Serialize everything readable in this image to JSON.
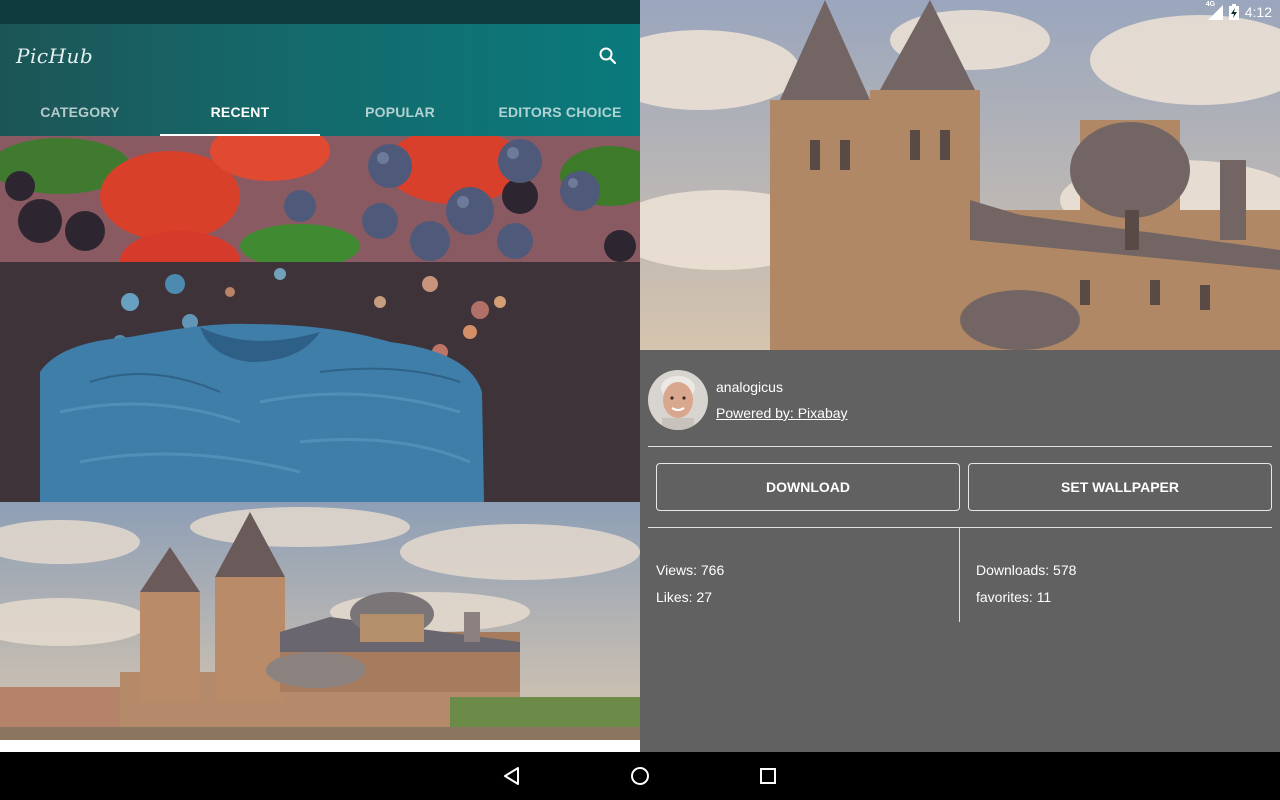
{
  "status": {
    "network": "4G",
    "time": "4:12"
  },
  "app": {
    "title": "PicHub"
  },
  "tabs": [
    {
      "label": "CATEGORY",
      "active": false
    },
    {
      "label": "RECENT",
      "active": true
    },
    {
      "label": "POPULAR",
      "active": false
    },
    {
      "label": "EDITORS CHOICE",
      "active": false
    }
  ],
  "feed": [
    {
      "subject": "berries"
    },
    {
      "subject": "blue sweater"
    },
    {
      "subject": "cathedral"
    }
  ],
  "detail": {
    "author": "analogicus",
    "powered_by": "Powered by: Pixabay",
    "download_label": "DOWNLOAD",
    "set_wallpaper_label": "SET WALLPAPER",
    "views": "Views: 766",
    "likes": "Likes: 27",
    "downloads": "Downloads: 578",
    "favorites": "favorites: 11"
  },
  "colors": {
    "appbar": "#14696b",
    "detail_bg": "#616161",
    "status_left": "#0e3b3d"
  }
}
